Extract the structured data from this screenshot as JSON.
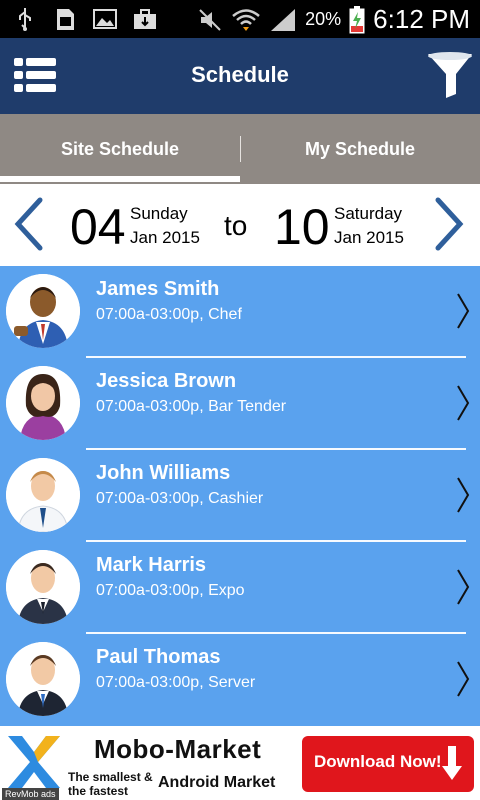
{
  "status_bar": {
    "icons": [
      "usb-icon",
      "sim-icon",
      "image-icon",
      "briefcase-icon",
      "mute-icon",
      "wifi-icon",
      "signal-icon",
      "battery-icon"
    ],
    "battery": "20%",
    "time": "6:12 PM"
  },
  "app_bar": {
    "title": "Schedule",
    "menu_icon": "list-menu-icon",
    "filter_icon": "filter-icon",
    "bg_color": "#1f3c6b"
  },
  "tabs": [
    {
      "label": "Site Schedule",
      "active": true
    },
    {
      "label": "My Schedule",
      "active": false
    }
  ],
  "date_range": {
    "start": {
      "day": "04",
      "weekday": "Sunday",
      "month": "Jan 2015"
    },
    "separator": "to",
    "end": {
      "day": "10",
      "weekday": "Saturday",
      "month": "Jan 2015"
    },
    "arrow_color": "#2f5f9b"
  },
  "shifts": [
    {
      "name": "James  Smith",
      "detail": "07:00a-03:00p, Chef",
      "avatar": "businessman-icon"
    },
    {
      "name": "Jessica  Brown",
      "detail": "07:00a-03:00p, Bar Tender",
      "avatar": "woman-icon"
    },
    {
      "name": "John  Williams",
      "detail": "07:00a-03:00p, Cashier",
      "avatar": "man-icon"
    },
    {
      "name": "Mark  Harris",
      "detail": "07:00a-03:00p, Expo",
      "avatar": "man-icon"
    },
    {
      "name": "Paul  Thomas",
      "detail": "07:00a-03:00p, Server",
      "avatar": "man-icon"
    }
  ],
  "list_color": "#5aa2ee",
  "ad": {
    "title": "Mobo-Market",
    "tagline_1": "The smallest &",
    "tagline_2": "the fastest",
    "subtitle": "Android Market",
    "button": "Download Now!",
    "badge": "RevMob ads"
  }
}
